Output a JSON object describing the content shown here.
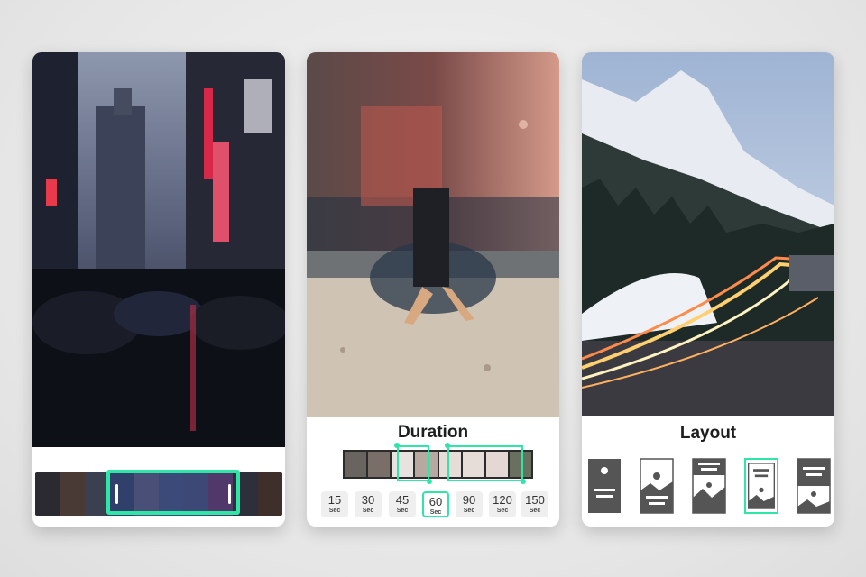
{
  "cards": [
    {
      "id": "timeline-trim",
      "frames": [
        "#2a2a30",
        "#4a3a36",
        "#3a4050",
        "#30406a",
        "#4a4f78",
        "#3b4a78",
        "#3d4876",
        "#50386a",
        "#2d2f3a",
        "#3e2f2a"
      ]
    },
    {
      "id": "duration",
      "title": "Duration",
      "options": [
        {
          "value": "15",
          "unit": "Sec"
        },
        {
          "value": "30",
          "unit": "Sec"
        },
        {
          "value": "45",
          "unit": "Sec"
        },
        {
          "value": "60",
          "unit": "Sec",
          "selected": true
        },
        {
          "value": "90",
          "unit": "Sec"
        },
        {
          "value": "120",
          "unit": "Sec"
        },
        {
          "value": "150",
          "unit": "Sec"
        }
      ],
      "frames": [
        "#6a6460",
        "#7a6f68",
        "#e8e2e0",
        "#b8a8a2",
        "#e6dcd8",
        "#e6dcd8",
        "#e4d8d4",
        "#6a7060"
      ]
    },
    {
      "id": "layout",
      "title": "Layout",
      "options": [
        {
          "name": "layout-image-top-text-bottom"
        },
        {
          "name": "layout-outline-image-text"
        },
        {
          "name": "layout-text-top-image-bottom"
        },
        {
          "name": "layout-outline-text-image",
          "selected": true
        },
        {
          "name": "layout-dark-text-image"
        }
      ]
    }
  ],
  "colors": {
    "accent": "#2ee6a6",
    "layout_icon": "#555555"
  }
}
